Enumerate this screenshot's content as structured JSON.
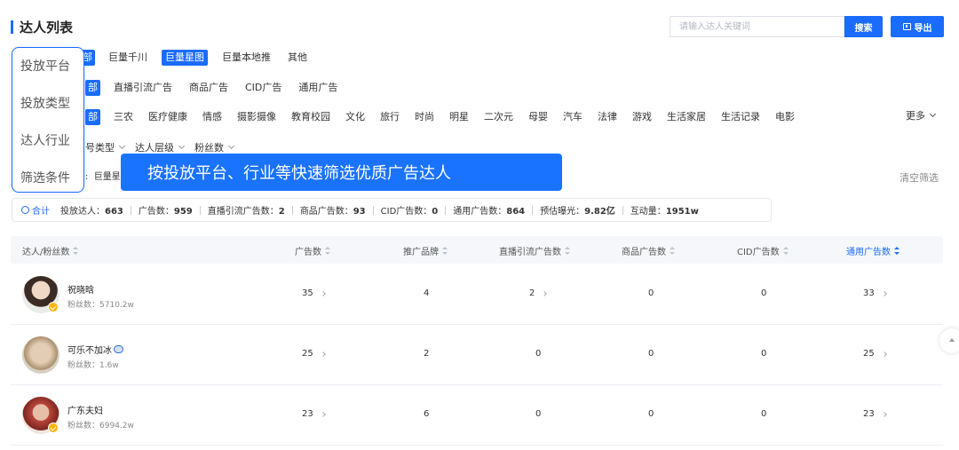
{
  "page": {
    "title": "达人列表"
  },
  "search": {
    "placeholder": "请输入达人关键词",
    "button": "搜索"
  },
  "export": {
    "label": "导出"
  },
  "filters": {
    "platform": {
      "partial": "部",
      "options": [
        "巨量千川",
        "巨量星图",
        "巨量本地推",
        "其他"
      ],
      "active": "巨量星图"
    },
    "ad_type": {
      "partial": "部",
      "options": [
        "直播引流广告",
        "商品广告",
        "CID广告",
        "通用广告"
      ]
    },
    "industry": {
      "partial": "部",
      "options": [
        "三农",
        "医疗健康",
        "情感",
        "摄影摄像",
        "教育校园",
        "文化",
        "旅行",
        "时尚",
        "明星",
        "二次元",
        "母婴",
        "汽车",
        "法律",
        "游戏",
        "生活家居",
        "生活记录",
        "电影"
      ],
      "more": "更多"
    },
    "conditions": {
      "dropdowns": [
        "号类型",
        "达人层级",
        "粉丝数"
      ]
    },
    "selected": {
      "prefix": ":",
      "value": "巨量星"
    },
    "clear": "清空筛选"
  },
  "left_panel": {
    "items": [
      "投放平台",
      "投放类型",
      "达人行业",
      "筛选条件"
    ]
  },
  "banner": {
    "text": "按投放平台、行业等快速筛选优质广告达人"
  },
  "summary": {
    "total_label": "合计",
    "stats": [
      {
        "label": "投放达人：",
        "value": "663"
      },
      {
        "label": "广告数：",
        "value": "959"
      },
      {
        "label": "直播引流广告数：",
        "value": "2"
      },
      {
        "label": "商品广告数：",
        "value": "93"
      },
      {
        "label": "CID广告数：",
        "value": "0"
      },
      {
        "label": "通用广告数：",
        "value": "864"
      },
      {
        "label": "预估曝光：",
        "value": "9.82亿"
      },
      {
        "label": "互动量：",
        "value": "1951w"
      }
    ]
  },
  "table": {
    "columns": [
      "达人/粉丝数",
      "广告数",
      "推广品牌",
      "直播引流广告数",
      "商品广告数",
      "CID广告数",
      "通用广告数"
    ],
    "sorted_column": "通用广告数",
    "rows": [
      {
        "name": "祝晓晗",
        "fans_label": "粉丝数：",
        "fans": "5710.2w",
        "ads": "35",
        "brands": "4",
        "live": "2",
        "product": "0",
        "cid": "0",
        "general": "33",
        "verified": true,
        "avatar_color": "#d9c7b8"
      },
      {
        "name": "可乐不加冰",
        "fans_label": "粉丝数：",
        "fans": "1.6w",
        "ads": "25",
        "brands": "2",
        "live": "0",
        "product": "0",
        "cid": "0",
        "general": "25",
        "verified": false,
        "avatar_color": "#c9b59c"
      },
      {
        "name": "广东夫妇",
        "fans_label": "粉丝数：",
        "fans": "6994.2w",
        "ads": "23",
        "brands": "6",
        "live": "0",
        "product": "0",
        "cid": "0",
        "general": "23",
        "verified": true,
        "avatar_color": "#b84a3c"
      }
    ]
  }
}
